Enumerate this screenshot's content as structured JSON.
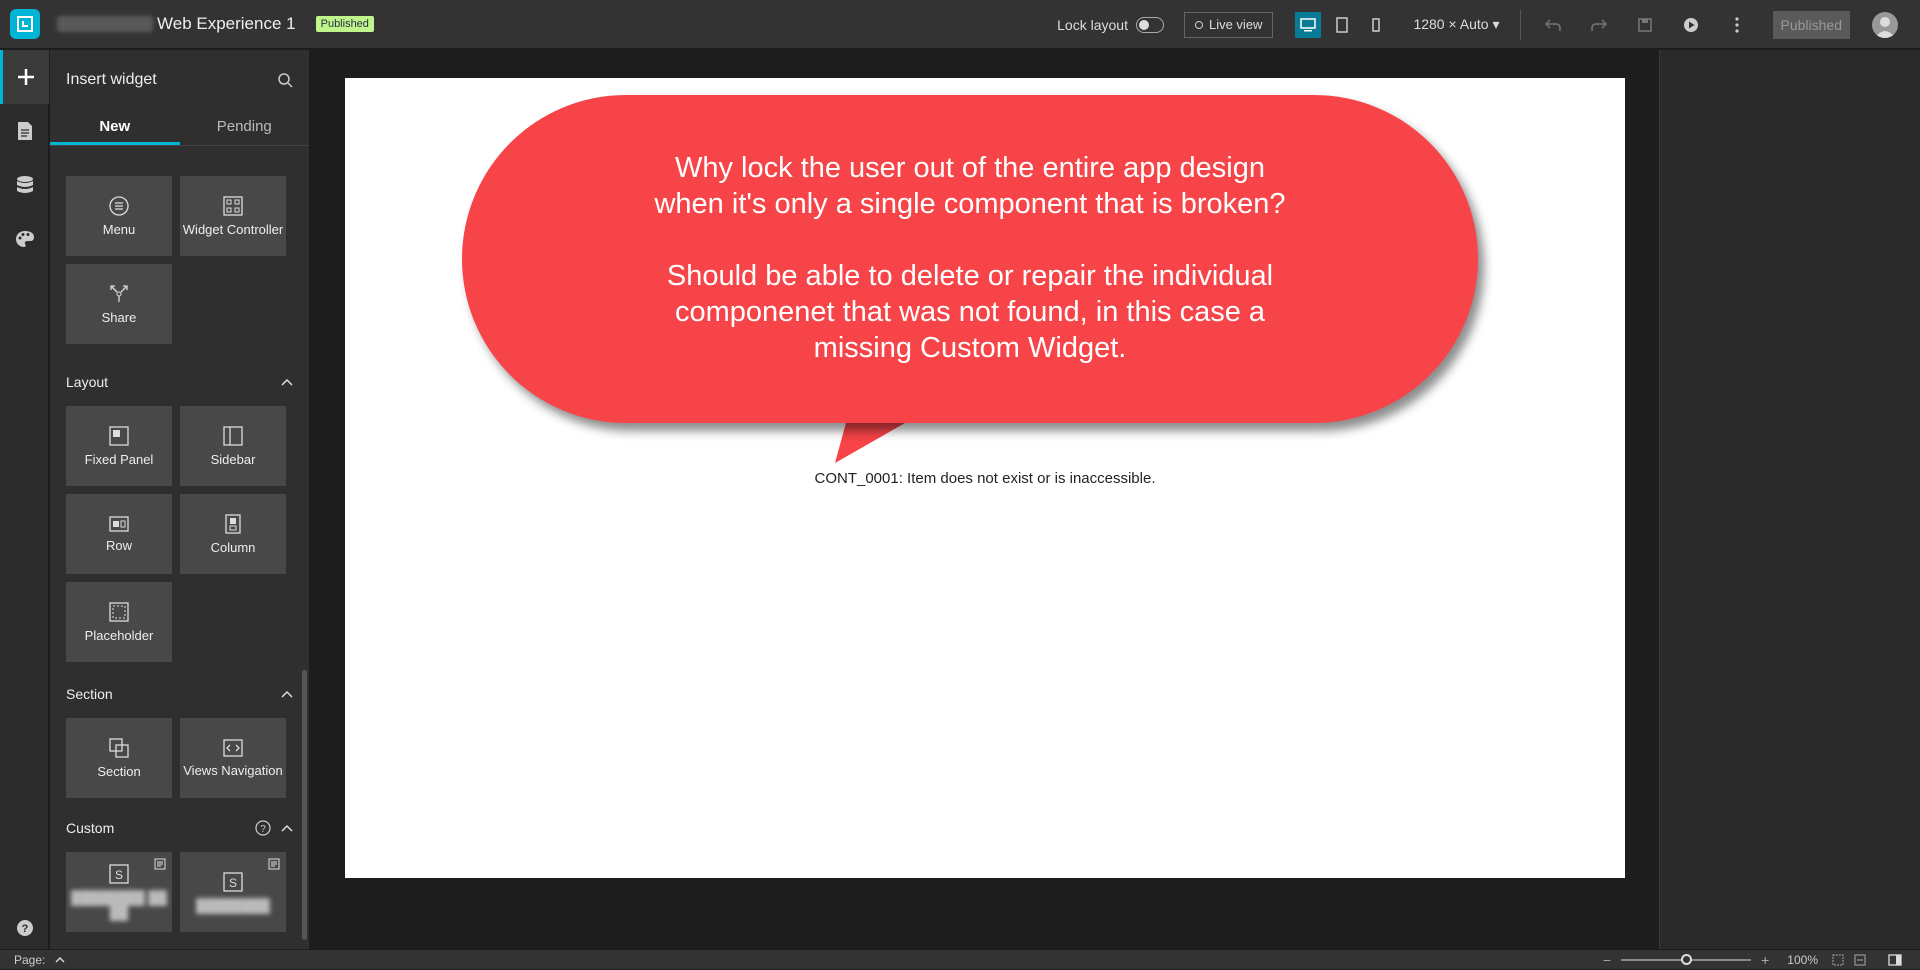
{
  "app": {
    "owner_redacted": "",
    "title": "Web Experience 1",
    "status_badge": "Published"
  },
  "toolbar": {
    "lock_layout_label": "Lock layout",
    "live_view_label": "Live view",
    "screen_size": "1280 × Auto",
    "publish_label": "Published"
  },
  "panel": {
    "title": "Insert widget",
    "tabs": [
      {
        "label": "New"
      },
      {
        "label": "Pending"
      }
    ],
    "top_widgets": [
      {
        "label": "Menu",
        "icon": "menu-icon"
      },
      {
        "label": "Widget Controller",
        "icon": "widget-controller-icon"
      },
      {
        "label": "Share",
        "icon": "share-icon"
      }
    ],
    "layout": {
      "heading": "Layout",
      "widgets": [
        {
          "label": "Fixed Panel"
        },
        {
          "label": "Sidebar"
        },
        {
          "label": "Row"
        },
        {
          "label": "Column"
        },
        {
          "label": "Placeholder"
        }
      ]
    },
    "section": {
      "heading": "Section",
      "widgets": [
        {
          "label": "Section"
        },
        {
          "label": "Views Navigation"
        }
      ]
    },
    "custom": {
      "heading": "Custom",
      "widgets": [
        {
          "label": "████████ ██ ██"
        },
        {
          "label": "████████"
        }
      ]
    }
  },
  "canvas": {
    "error_message": "CONT_0001: Item does not exist or is inaccessible.",
    "callout_line1": "Why lock the user out of the entire app design",
    "callout_line2": "when it's only a single component that is broken?",
    "callout_line3": "Should be able to delete or repair the individual",
    "callout_line4": "componenet that was not found, in this case a",
    "callout_line5": "missing Custom Widget.",
    "callout_color": "#f64448"
  },
  "status": {
    "page_label": "Page:",
    "zoom": "100%",
    "zoom_fraction": 0.5
  },
  "colors": {
    "accent": "#00b4d6",
    "badge": "#bff58a"
  }
}
